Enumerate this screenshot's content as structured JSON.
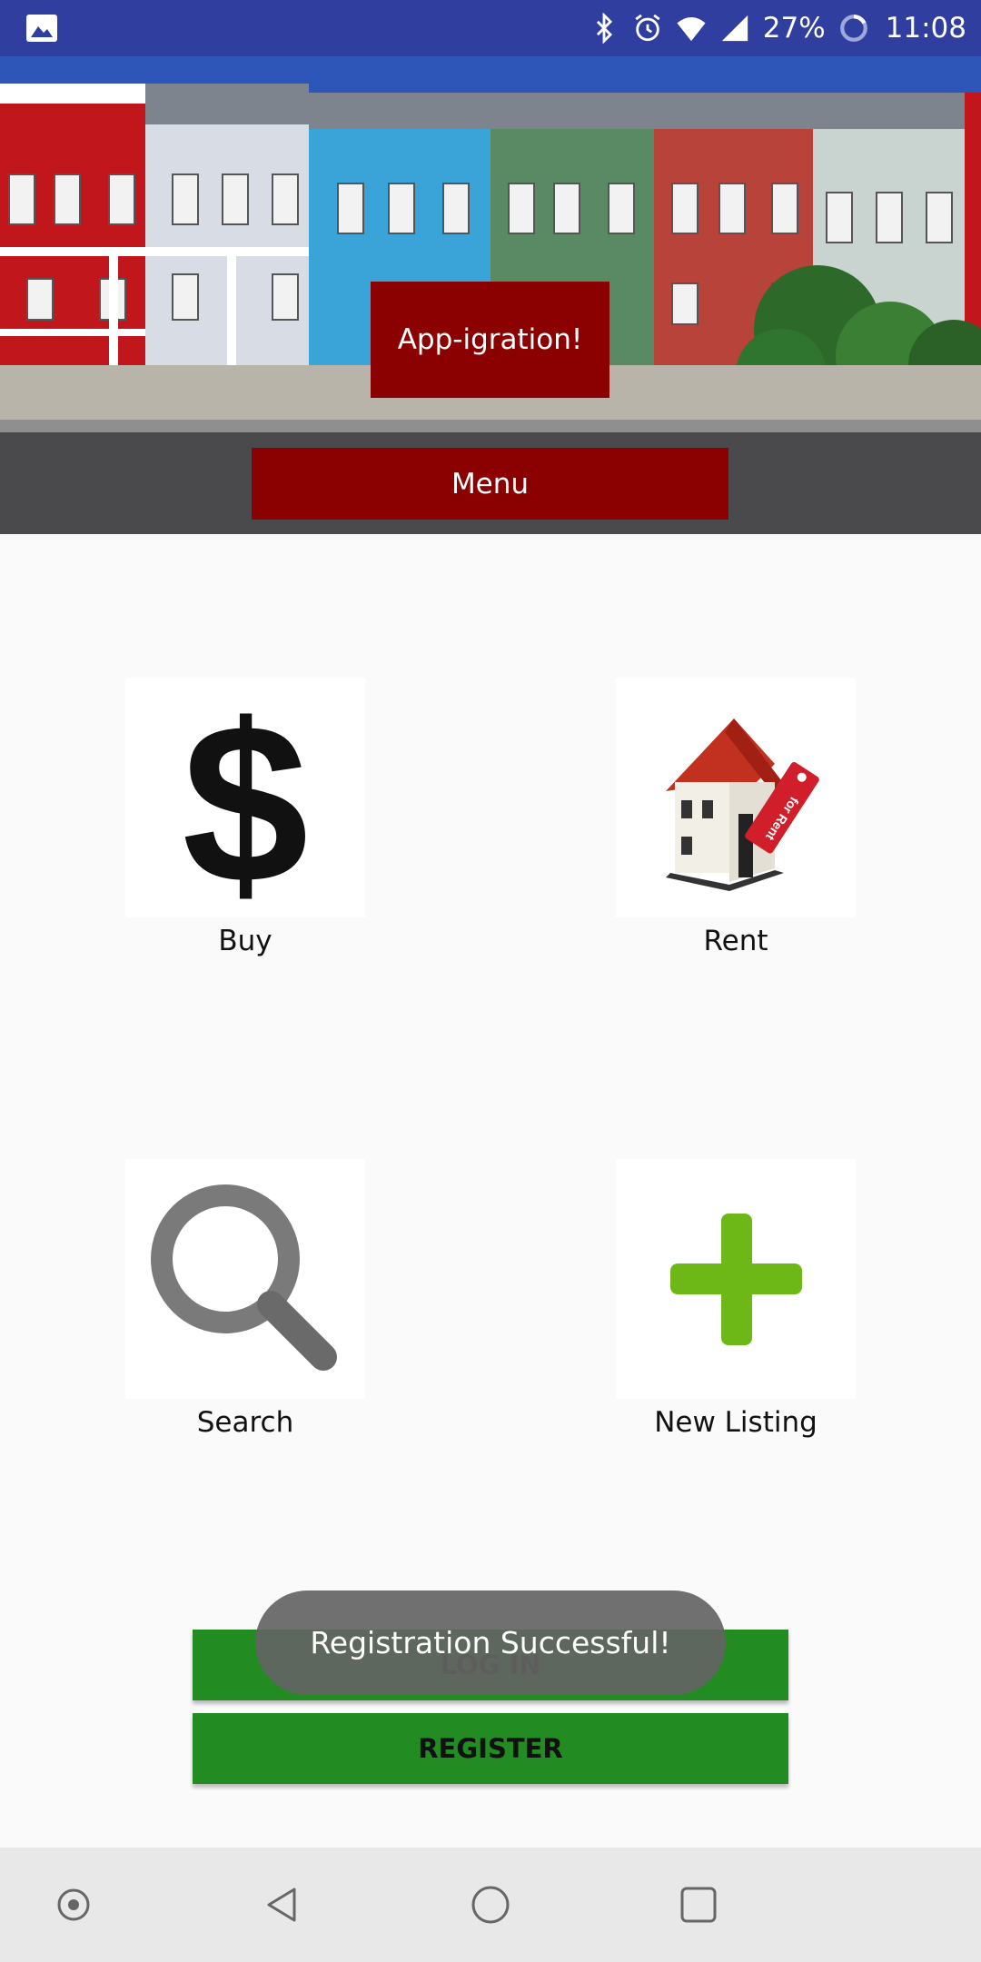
{
  "status_bar": {
    "battery": "27%",
    "time": "11:08",
    "icons": [
      "gallery-icon",
      "bluetooth-icon",
      "alarm-icon",
      "wifi-icon",
      "signal-icon",
      "battery-icon"
    ]
  },
  "header": {
    "title": "App-igration!",
    "menu_label": "Menu"
  },
  "tiles": [
    {
      "label": "Buy",
      "icon": "dollar-icon"
    },
    {
      "label": "Rent",
      "icon": "house-for-rent-icon"
    },
    {
      "label": "Search",
      "icon": "magnifier-icon"
    },
    {
      "label": "New Listing",
      "icon": "plus-icon"
    }
  ],
  "buttons": {
    "login_label": "LOG IN",
    "register_label": "REGISTER"
  },
  "toast": {
    "message": "Registration Successful!"
  },
  "nav": [
    "assist-icon",
    "back-icon",
    "home-icon",
    "recents-icon"
  ],
  "colors": {
    "status_bar": "#303f9f",
    "header_button": "#8b0000",
    "green_button": "#228b22"
  }
}
